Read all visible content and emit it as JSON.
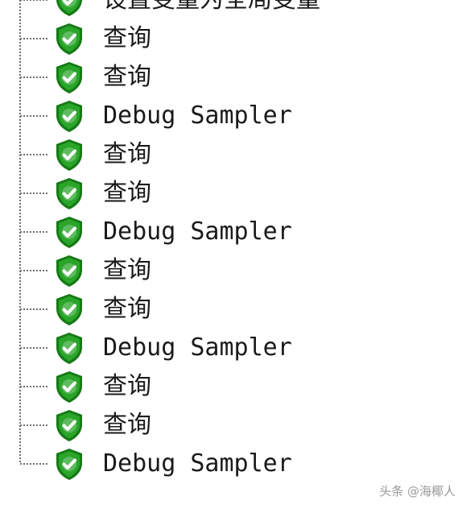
{
  "tree": {
    "items": [
      {
        "label": "设置变量为全局变量",
        "icon": "green-shield-check-icon"
      },
      {
        "label": "查询",
        "icon": "green-shield-check-icon"
      },
      {
        "label": "查询",
        "icon": "green-shield-check-icon"
      },
      {
        "label": "Debug Sampler",
        "icon": "green-shield-check-icon"
      },
      {
        "label": "查询",
        "icon": "green-shield-check-icon"
      },
      {
        "label": "查询",
        "icon": "green-shield-check-icon"
      },
      {
        "label": "Debug Sampler",
        "icon": "green-shield-check-icon"
      },
      {
        "label": "查询",
        "icon": "green-shield-check-icon"
      },
      {
        "label": "查询",
        "icon": "green-shield-check-icon"
      },
      {
        "label": "Debug Sampler",
        "icon": "green-shield-check-icon"
      },
      {
        "label": "查询",
        "icon": "green-shield-check-icon"
      },
      {
        "label": "查询",
        "icon": "green-shield-check-icon"
      },
      {
        "label": "Debug Sampler",
        "icon": "green-shield-check-icon"
      }
    ]
  },
  "watermark": "头条 @海椰人",
  "colors": {
    "shield": "#2aa52a",
    "shield_dark": "#157a15",
    "connector": "#6f6f6f"
  }
}
